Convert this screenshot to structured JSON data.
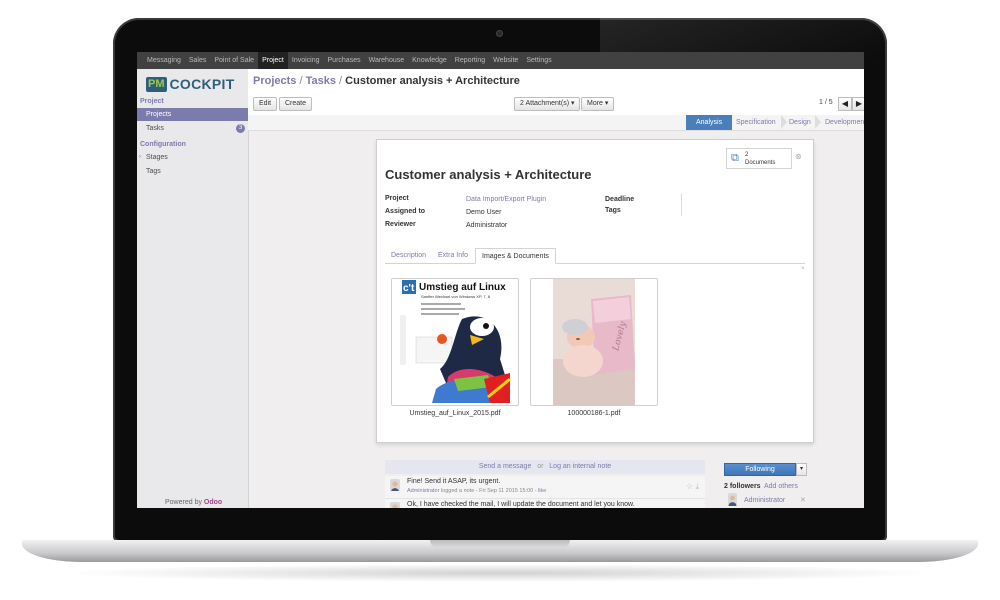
{
  "topbar": {
    "menu": [
      "Messaging",
      "Sales",
      "Point of Sale",
      "Project",
      "Invoicing",
      "Purchases",
      "Warehouse",
      "Knowledge",
      "Reporting",
      "Website",
      "Settings"
    ],
    "active": "Project"
  },
  "sidebar": {
    "logo_badge": "PM",
    "logo_text": "COCKPIT",
    "section_project": "Project",
    "item_projects": "Projects",
    "item_tasks": "Tasks",
    "tasks_count": "3",
    "section_configuration": "Configuration",
    "item_stages": "Stages",
    "item_tags": "Tags",
    "powered_by": "Powered by",
    "powered_brand": "Odoo"
  },
  "header": {
    "crumb_projects": "Projects",
    "crumb_tasks": "Tasks",
    "crumb_current": "Customer analysis + Architecture",
    "sep": "/",
    "edit_label": "Edit",
    "create_label": "Create",
    "attachments_label": "2 Attachment(s) ▾",
    "more_label": "More ▾",
    "pager": "1 / 5",
    "prev_icon": "◀",
    "next_icon": "▶"
  },
  "stages": [
    "Analysis",
    "Specification",
    "Design",
    "Development"
  ],
  "active_stage": "Analysis",
  "form": {
    "doc_count": "2",
    "doc_label": "Documents",
    "close_icon": "⊗",
    "title": "Customer analysis + Architecture",
    "fields": {
      "project_label": "Project",
      "project_value": "Data Import/Export Plugin",
      "assigned_label": "Assigned to",
      "assigned_value": "Demo User",
      "reviewer_label": "Reviewer",
      "reviewer_value": "Administrator",
      "deadline_label": "Deadline",
      "tags_label": "Tags"
    },
    "tabs": [
      "Description",
      "Extra Info",
      "Images & Documents"
    ],
    "active_tab": "Images & Documents",
    "attachments": [
      {
        "filename": "Umstieg_auf_Linux_2015.pdf",
        "cover_logo": "c't",
        "cover_title": "Umstieg auf Linux",
        "cover_subtitle": "Sanfter Wechsel von Windows XP, 7, 8"
      },
      {
        "filename": "100000186-1.pdf",
        "card_text": "Lovely"
      }
    ]
  },
  "chatter": {
    "send_message": "Send a message",
    "or": "or",
    "log_note": "Log an internal note",
    "messages": [
      {
        "text": "Fine! Send it ASAP, its urgent.",
        "author": "Administrator",
        "meta": "logged a note - Fri Sep 11 2015 15:00 -",
        "like": "like"
      },
      {
        "text": "Ok, I have checked the mail, I will update the document and let you know."
      }
    ],
    "follow_label": "Following",
    "followers_label": "2 followers",
    "add_others": "Add others",
    "follower_name": "Administrator",
    "remove_icon": "✕"
  },
  "colors": {
    "accent": "#7c7bad",
    "stage_active": "#4c7fb9",
    "topbar": "#414141"
  }
}
